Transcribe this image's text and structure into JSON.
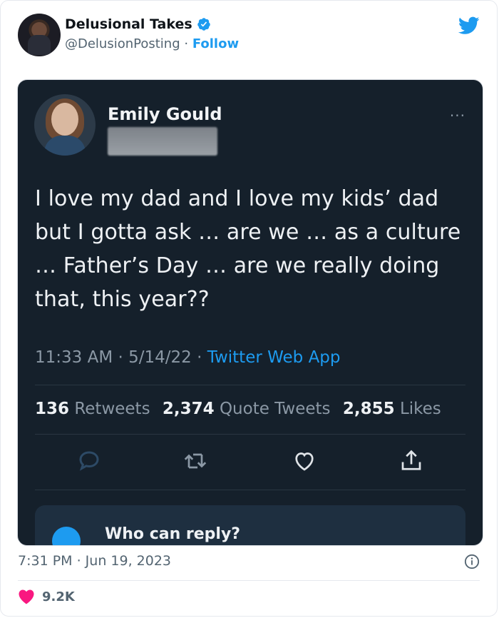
{
  "tweet": {
    "author": {
      "name": "Delusional Takes",
      "handle": "@DelusionPosting",
      "separator": " · ",
      "follow_label": "Follow"
    },
    "timestamp": "7:31 PM · Jun 19, 2023",
    "likes": "9.2K"
  },
  "screenshot": {
    "name": "Emily Gould",
    "body": "I love my dad and I love my kids’ dad but I gotta ask … are we … as a culture … Father’s Day … are we really doing that, this year??",
    "time": "11:33 AM",
    "date": "5/14/22",
    "dot": " · ",
    "app": "Twitter Web App",
    "stats": {
      "retweets_count": "136",
      "retweets_label": "Retweets",
      "quotes_count": "2,374",
      "quotes_label": "Quote Tweets",
      "likes_count": "2,855",
      "likes_label": "Likes"
    },
    "reply_prompt": "Who can reply?",
    "more": "···"
  },
  "icons": [
    "verified-badge-icon",
    "twitter-bird-icon",
    "reply-icon",
    "retweet-icon",
    "like-icon",
    "share-icon",
    "info-icon",
    "heart-icon"
  ],
  "colors": {
    "accent": "#1d9bf0",
    "like": "#f91880",
    "dark_bg": "#15202b"
  }
}
